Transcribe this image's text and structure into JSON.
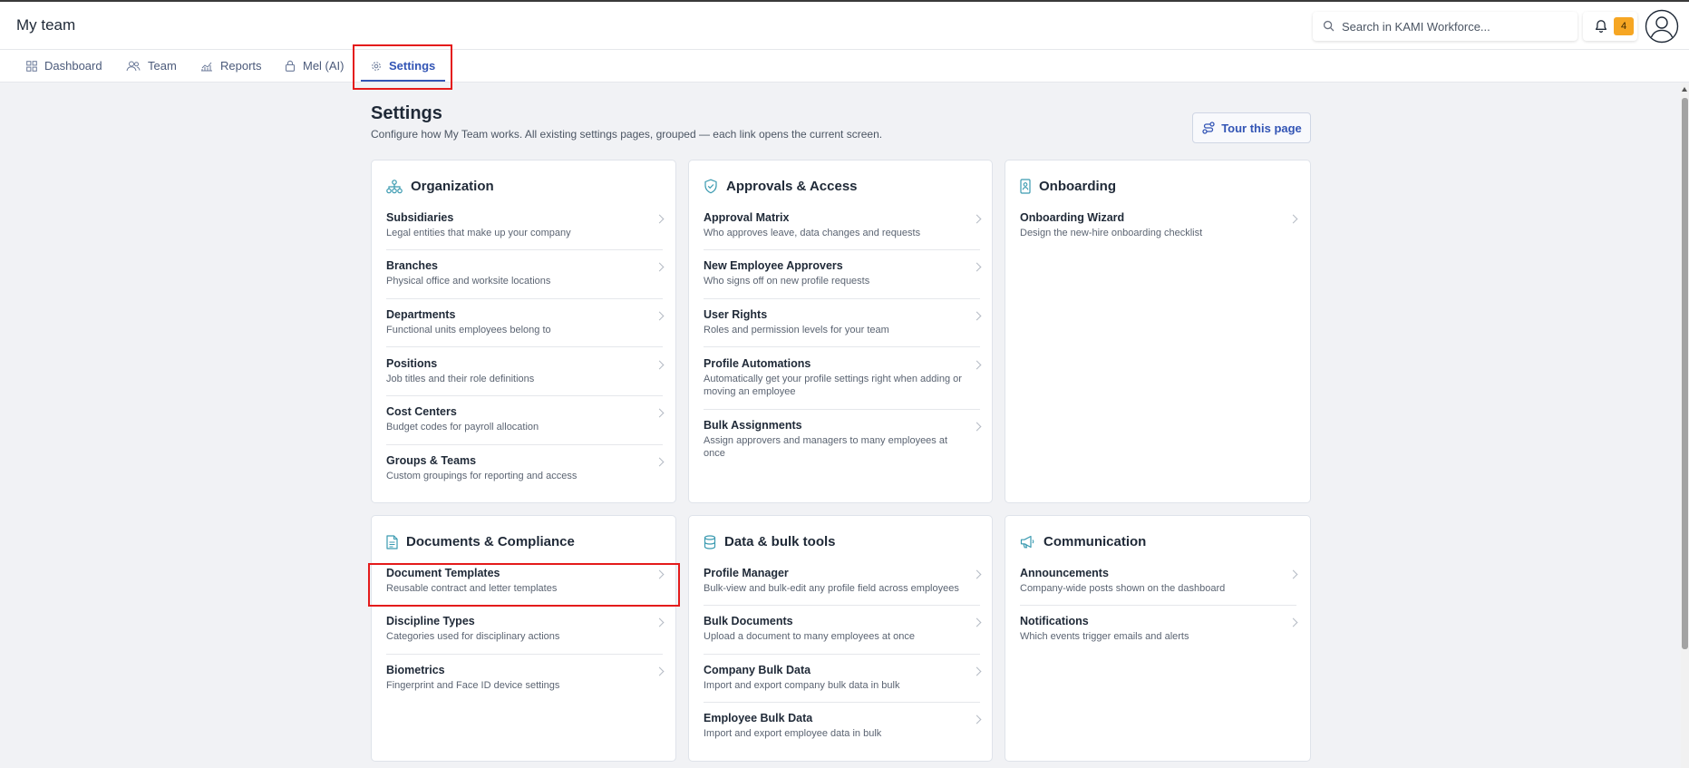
{
  "app": {
    "title": "My team"
  },
  "header": {
    "search_placeholder": "Search in KAMI Workforce...",
    "notification_count": "4"
  },
  "tabs": [
    {
      "label": "Dashboard",
      "icon": "grid-icon"
    },
    {
      "label": "Team",
      "icon": "users-icon"
    },
    {
      "label": "Reports",
      "icon": "chart-icon"
    },
    {
      "label": "Mel (AI)",
      "icon": "lock-icon"
    },
    {
      "label": "Settings",
      "icon": "gear-icon",
      "active": true
    }
  ],
  "page": {
    "title": "Settings",
    "subtitle": "Configure how My Team works. All existing settings pages, grouped — each link opens the current screen.",
    "tour_label": "Tour this page"
  },
  "cards": {
    "organization": {
      "title": "Organization",
      "icon": "org-chart-icon",
      "items": [
        {
          "title": "Subsidiaries",
          "desc": "Legal entities that make up your company"
        },
        {
          "title": "Branches",
          "desc": "Physical office and worksite locations"
        },
        {
          "title": "Departments",
          "desc": "Functional units employees belong to"
        },
        {
          "title": "Positions",
          "desc": "Job titles and their role definitions"
        },
        {
          "title": "Cost Centers",
          "desc": "Budget codes for payroll allocation"
        },
        {
          "title": "Groups & Teams",
          "desc": "Custom groupings for reporting and access"
        }
      ]
    },
    "approvals": {
      "title": "Approvals & Access",
      "icon": "shield-check-icon",
      "items": [
        {
          "title": "Approval Matrix",
          "desc": "Who approves leave, data changes and requests"
        },
        {
          "title": "New Employee Approvers",
          "desc": "Who signs off on new profile requests"
        },
        {
          "title": "User Rights",
          "desc": "Roles and permission levels for your team"
        },
        {
          "title": "Profile Automations",
          "desc": "Automatically get your profile settings right when adding or moving an employee"
        },
        {
          "title": "Bulk Assignments",
          "desc": "Assign approvers and managers to many employees at once"
        }
      ]
    },
    "onboarding": {
      "title": "Onboarding",
      "icon": "badge-icon",
      "items": [
        {
          "title": "Onboarding Wizard",
          "desc": "Design the new-hire onboarding checklist"
        }
      ]
    },
    "documents": {
      "title": "Documents & Compliance",
      "icon": "document-icon",
      "items": [
        {
          "title": "Document Templates",
          "desc": "Reusable contract and letter templates"
        },
        {
          "title": "Discipline Types",
          "desc": "Categories used for disciplinary actions"
        },
        {
          "title": "Biometrics",
          "desc": "Fingerprint and Face ID device settings"
        }
      ]
    },
    "data": {
      "title": "Data & bulk tools",
      "icon": "database-icon",
      "items": [
        {
          "title": "Profile Manager",
          "desc": "Bulk-view and bulk-edit any profile field across employees"
        },
        {
          "title": "Bulk Documents",
          "desc": "Upload a document to many employees at once"
        },
        {
          "title": "Company Bulk Data",
          "desc": "Import and export company bulk data in bulk"
        },
        {
          "title": "Employee Bulk Data",
          "desc": "Import and export employee data in bulk"
        }
      ]
    },
    "communication": {
      "title": "Communication",
      "icon": "megaphone-icon",
      "items": [
        {
          "title": "Announcements",
          "desc": "Company-wide posts shown on the dashboard"
        },
        {
          "title": "Notifications",
          "desc": "Which events trigger emails and alerts"
        }
      ]
    }
  },
  "colors": {
    "accent": "#3355b5",
    "highlight": "#e41b1b",
    "badge": "#f6a623"
  }
}
